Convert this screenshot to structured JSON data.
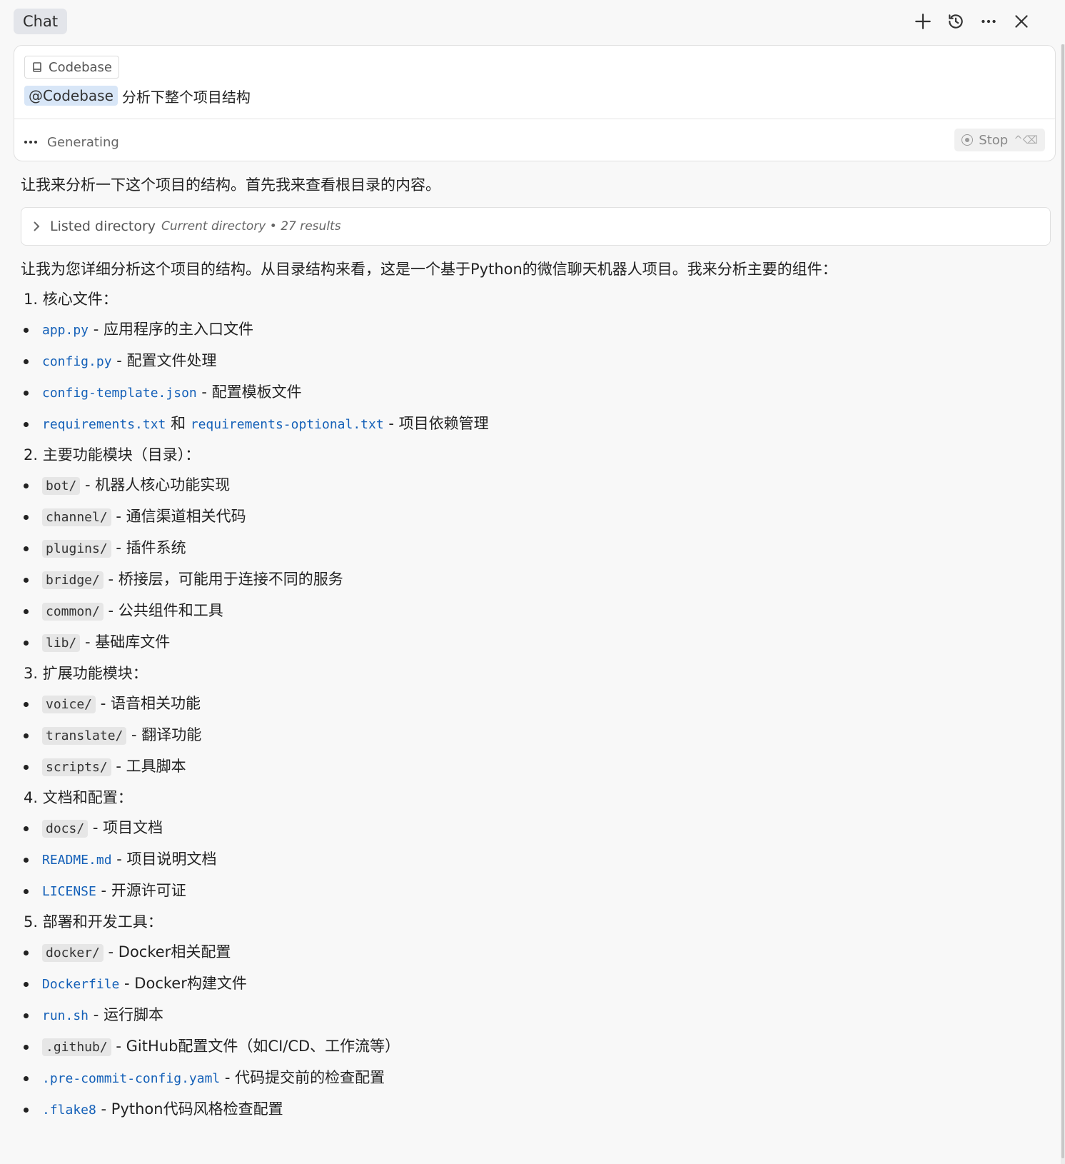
{
  "header": {
    "tab_label": "Chat"
  },
  "input": {
    "chip_label": "Codebase",
    "mention": "@Codebase",
    "query": "分析下整个项目结构",
    "status": "Generating",
    "stop_label": "Stop",
    "stop_shortcut": "^⌫"
  },
  "response": {
    "intro": "让我来分析一下这个项目的结构。首先我来查看根目录的内容。",
    "tool": {
      "label": "Listed directory",
      "meta": "Current directory • 27 results"
    },
    "summary": "让我为您详细分析这个项目的结构。从目录结构来看，这是一个基于Python的微信聊天机器人项目。我来分析主要的组件：",
    "sections": [
      {
        "title": "1. 核心文件：",
        "items": [
          {
            "code": "app.py",
            "desc": " - 应用程序的主入口文件"
          },
          {
            "code": "config.py",
            "desc": " - 配置文件处理"
          },
          {
            "code": "config-template.json",
            "desc": " - 配置模板文件"
          },
          {
            "code": "requirements.txt",
            "mid": " 和 ",
            "code2": "requirements-optional.txt",
            "desc": " - 项目依赖管理"
          }
        ]
      },
      {
        "title": "2. 主要功能模块（目录）：",
        "items": [
          {
            "code": "bot/",
            "desc": " - 机器人核心功能实现"
          },
          {
            "code": "channel/",
            "desc": " - 通信渠道相关代码"
          },
          {
            "code": "plugins/",
            "desc": " - 插件系统"
          },
          {
            "code": "bridge/",
            "desc": " - 桥接层，可能用于连接不同的服务"
          },
          {
            "code": "common/",
            "desc": " - 公共组件和工具"
          },
          {
            "code": "lib/",
            "desc": " - 基础库文件"
          }
        ]
      },
      {
        "title": "3. 扩展功能模块：",
        "items": [
          {
            "code": "voice/",
            "desc": " - 语音相关功能"
          },
          {
            "code": "translate/",
            "desc": " - 翻译功能"
          },
          {
            "code": "scripts/",
            "desc": " - 工具脚本"
          }
        ]
      },
      {
        "title": "4. 文档和配置：",
        "items": [
          {
            "code": "docs/",
            "desc": " - 项目文档"
          },
          {
            "code": "README.md",
            "desc": " - 项目说明文档"
          },
          {
            "code": "LICENSE",
            "desc": " - 开源许可证"
          }
        ]
      },
      {
        "title": "5. 部署和开发工具：",
        "items": [
          {
            "code": "docker/",
            "desc": " - Docker相关配置"
          },
          {
            "code": "Dockerfile",
            "desc": " - Docker构建文件"
          },
          {
            "code": "run.sh",
            "desc": " - 运行脚本"
          },
          {
            "code": ".github/",
            "desc": " - GitHub配置文件（如CI/CD、工作流等）"
          },
          {
            "code": ".pre-commit-config.yaml",
            "desc": " - 代码提交前的检查配置"
          },
          {
            "code": ".flake8",
            "desc": " - Python代码风格检查配置"
          }
        ]
      }
    ]
  }
}
